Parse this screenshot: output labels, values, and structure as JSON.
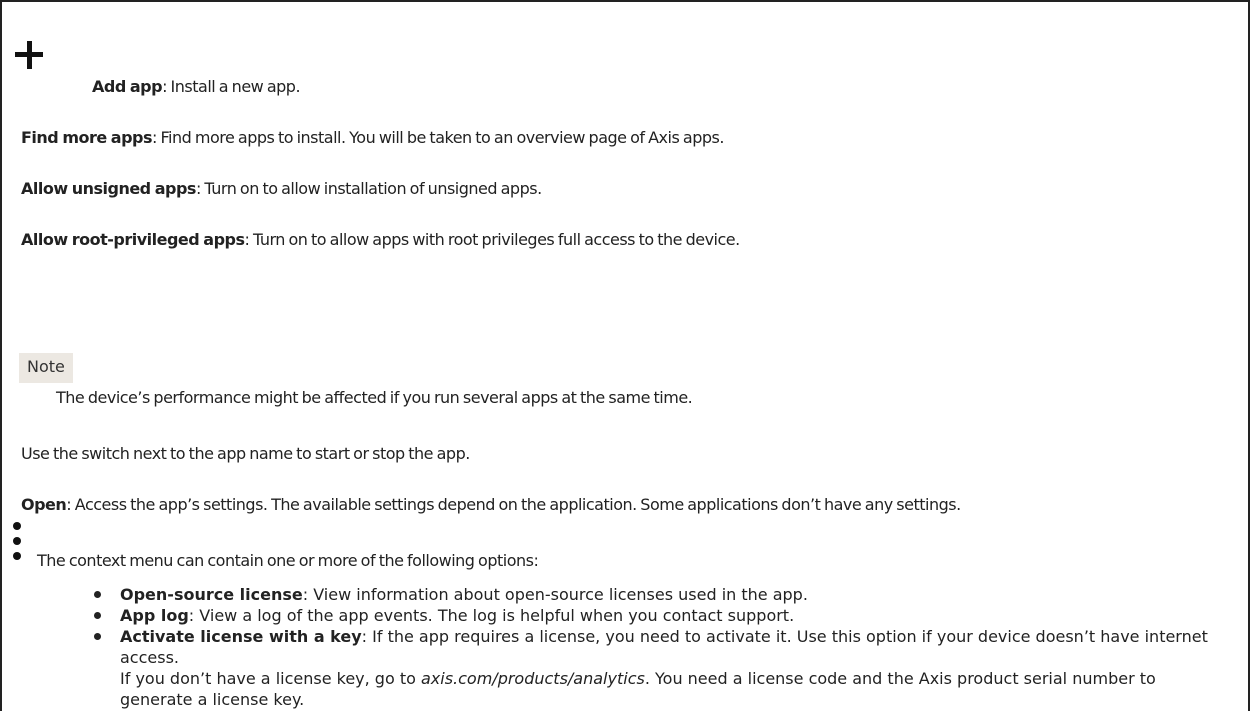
{
  "add_app": {
    "icon": "plus-icon",
    "title": "Add app",
    "description": ": Install a new app."
  },
  "find_more": {
    "title": "Find more apps",
    "description": ": Find more apps to install. You will be taken to an overview page of Axis apps."
  },
  "allow_unsigned": {
    "title": "Allow unsigned apps",
    "description": ": Turn on to allow installation of unsigned apps."
  },
  "allow_root": {
    "title": "Allow root-privileged apps",
    "description": ": Turn on to allow apps with root privileges full access to the device."
  },
  "note": {
    "label": "Note",
    "text": "The device’s performance might be affected if you run several apps at the same time."
  },
  "switch_text": "Use the switch next to the app name to start or stop the app.",
  "open": {
    "title": "Open",
    "description": ": Access the app’s settings. The available settings depend on the application. Some applications don’t have any settings."
  },
  "context_menu": {
    "icon": "kebab-menu-icon",
    "intro": "The context menu can contain one or more of the following options:",
    "items": [
      {
        "title": "Open-source license",
        "description": ": View information about open-source licenses used in the app."
      },
      {
        "title": "App log",
        "description": ": View a log of the app events. The log is helpful when you contact support."
      },
      {
        "title": "Activate license with a key",
        "description": ": If the app requires a license, you need to activate it. Use this option if your device doesn’t have internet access.",
        "extra_prefix": "If you don’t have a license key, go to ",
        "extra_link": "axis.com/products/analytics",
        "extra_suffix": ". You need a license code and the Axis product serial number to generate a license key."
      }
    ]
  }
}
